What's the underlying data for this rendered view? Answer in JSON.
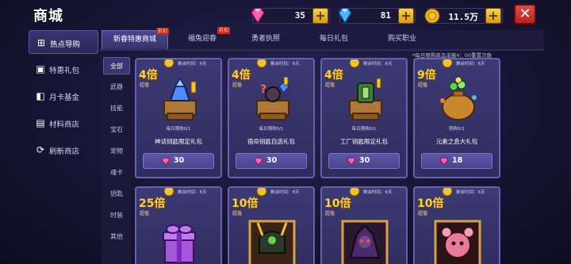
{
  "header": {
    "title": "商城"
  },
  "currencies": [
    {
      "icon": "pink-gem-icon",
      "value": "35",
      "color": "#ff5fae"
    },
    {
      "icon": "blue-diamond-icon",
      "value": "81",
      "color": "#45b7ff"
    },
    {
      "icon": "gold-coin-icon",
      "value": "11.5万",
      "color": "#f5c22a"
    }
  ],
  "sidebar": {
    "items": [
      {
        "label": "热点导购",
        "icon": "cart-icon",
        "active": true
      },
      {
        "label": "特惠礼包",
        "icon": "gift-icon",
        "active": false
      },
      {
        "label": "月卡基金",
        "icon": "card-icon",
        "active": false
      },
      {
        "label": "材料商店",
        "icon": "shop-icon",
        "active": false
      },
      {
        "label": "刷新商店",
        "icon": "refresh-icon",
        "active": false
      }
    ]
  },
  "tabs": [
    {
      "label": "新春特惠商城",
      "badge": "折扣",
      "active": true
    },
    {
      "label": "福兔迎春",
      "badge": "折扣",
      "active": false
    },
    {
      "label": "勇者执照",
      "badge": "",
      "active": false
    },
    {
      "label": "每日礼包",
      "badge": "",
      "active": false
    },
    {
      "label": "购买职业",
      "badge": "",
      "active": false
    }
  ],
  "notice": "*每日限购商品凌晨4：00重置次数",
  "categories": [
    "全部",
    "武器",
    "技能",
    "宝石",
    "宠物",
    "魂卡",
    "钥匙",
    "时装",
    "其他"
  ],
  "cards": [
    {
      "multiplier": "4倍",
      "tag": "超值",
      "remain": "剩余时间：6天",
      "limit": "每日限购0/1",
      "name": "神话钥匙限定礼包",
      "price": "30",
      "art": "mythic-key-chest"
    },
    {
      "multiplier": "4倍",
      "tag": "超值",
      "remain": "剩余时间：6天",
      "limit": "每日限购0/1",
      "name": "宿命钥匙自选礼包",
      "price": "30",
      "art": "fate-key-chest"
    },
    {
      "multiplier": "4倍",
      "tag": "超值",
      "remain": "剩余时间：6天",
      "limit": "每日限购0/1",
      "name": "工厂钥匙限定礼包",
      "price": "30",
      "art": "factory-key-chest"
    },
    {
      "multiplier": "9倍",
      "tag": "超值",
      "remain": "剩余时间：6天",
      "limit": "限购0/1",
      "name": "元素之息大礼包",
      "price": "18",
      "art": "element-bag"
    },
    {
      "multiplier": "25倍",
      "tag": "超值",
      "remain": "剩余时间：6天",
      "art": "purple-gift-box"
    },
    {
      "multiplier": "10倍",
      "tag": "超值",
      "remain": "剩余时间：6天",
      "art": "samurai-helmet"
    },
    {
      "multiplier": "10倍",
      "tag": "超值",
      "remain": "剩余时间：6天",
      "art": "dark-mage"
    },
    {
      "multiplier": "10倍",
      "tag": "超值",
      "remain": "剩余时间：6天",
      "art": "pink-creature"
    }
  ],
  "colors": {
    "accent_gold": "#ffd23a",
    "card_border": "#6662ae",
    "close_red": "#d2362b"
  }
}
